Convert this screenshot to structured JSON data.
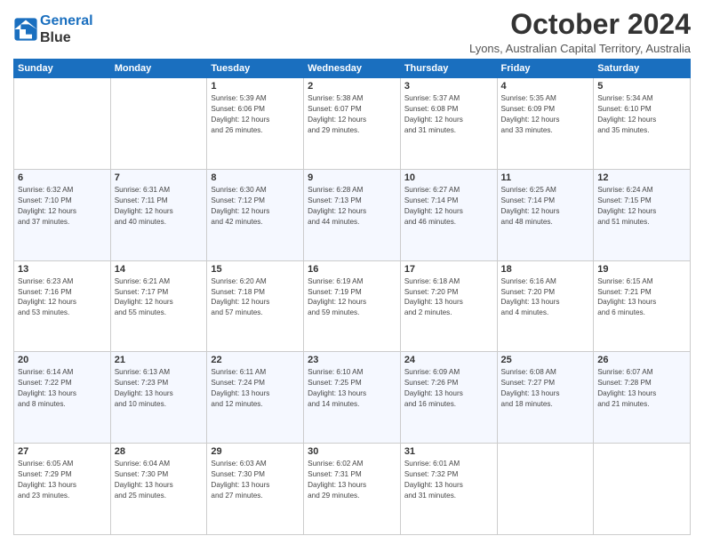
{
  "header": {
    "logo_line1": "General",
    "logo_line2": "Blue",
    "month": "October 2024",
    "location": "Lyons, Australian Capital Territory, Australia"
  },
  "days_of_week": [
    "Sunday",
    "Monday",
    "Tuesday",
    "Wednesday",
    "Thursday",
    "Friday",
    "Saturday"
  ],
  "weeks": [
    [
      {
        "day": "",
        "info": ""
      },
      {
        "day": "",
        "info": ""
      },
      {
        "day": "1",
        "info": "Sunrise: 5:39 AM\nSunset: 6:06 PM\nDaylight: 12 hours\nand 26 minutes."
      },
      {
        "day": "2",
        "info": "Sunrise: 5:38 AM\nSunset: 6:07 PM\nDaylight: 12 hours\nand 29 minutes."
      },
      {
        "day": "3",
        "info": "Sunrise: 5:37 AM\nSunset: 6:08 PM\nDaylight: 12 hours\nand 31 minutes."
      },
      {
        "day": "4",
        "info": "Sunrise: 5:35 AM\nSunset: 6:09 PM\nDaylight: 12 hours\nand 33 minutes."
      },
      {
        "day": "5",
        "info": "Sunrise: 5:34 AM\nSunset: 6:10 PM\nDaylight: 12 hours\nand 35 minutes."
      }
    ],
    [
      {
        "day": "6",
        "info": "Sunrise: 6:32 AM\nSunset: 7:10 PM\nDaylight: 12 hours\nand 37 minutes."
      },
      {
        "day": "7",
        "info": "Sunrise: 6:31 AM\nSunset: 7:11 PM\nDaylight: 12 hours\nand 40 minutes."
      },
      {
        "day": "8",
        "info": "Sunrise: 6:30 AM\nSunset: 7:12 PM\nDaylight: 12 hours\nand 42 minutes."
      },
      {
        "day": "9",
        "info": "Sunrise: 6:28 AM\nSunset: 7:13 PM\nDaylight: 12 hours\nand 44 minutes."
      },
      {
        "day": "10",
        "info": "Sunrise: 6:27 AM\nSunset: 7:14 PM\nDaylight: 12 hours\nand 46 minutes."
      },
      {
        "day": "11",
        "info": "Sunrise: 6:25 AM\nSunset: 7:14 PM\nDaylight: 12 hours\nand 48 minutes."
      },
      {
        "day": "12",
        "info": "Sunrise: 6:24 AM\nSunset: 7:15 PM\nDaylight: 12 hours\nand 51 minutes."
      }
    ],
    [
      {
        "day": "13",
        "info": "Sunrise: 6:23 AM\nSunset: 7:16 PM\nDaylight: 12 hours\nand 53 minutes."
      },
      {
        "day": "14",
        "info": "Sunrise: 6:21 AM\nSunset: 7:17 PM\nDaylight: 12 hours\nand 55 minutes."
      },
      {
        "day": "15",
        "info": "Sunrise: 6:20 AM\nSunset: 7:18 PM\nDaylight: 12 hours\nand 57 minutes."
      },
      {
        "day": "16",
        "info": "Sunrise: 6:19 AM\nSunset: 7:19 PM\nDaylight: 12 hours\nand 59 minutes."
      },
      {
        "day": "17",
        "info": "Sunrise: 6:18 AM\nSunset: 7:20 PM\nDaylight: 13 hours\nand 2 minutes."
      },
      {
        "day": "18",
        "info": "Sunrise: 6:16 AM\nSunset: 7:20 PM\nDaylight: 13 hours\nand 4 minutes."
      },
      {
        "day": "19",
        "info": "Sunrise: 6:15 AM\nSunset: 7:21 PM\nDaylight: 13 hours\nand 6 minutes."
      }
    ],
    [
      {
        "day": "20",
        "info": "Sunrise: 6:14 AM\nSunset: 7:22 PM\nDaylight: 13 hours\nand 8 minutes."
      },
      {
        "day": "21",
        "info": "Sunrise: 6:13 AM\nSunset: 7:23 PM\nDaylight: 13 hours\nand 10 minutes."
      },
      {
        "day": "22",
        "info": "Sunrise: 6:11 AM\nSunset: 7:24 PM\nDaylight: 13 hours\nand 12 minutes."
      },
      {
        "day": "23",
        "info": "Sunrise: 6:10 AM\nSunset: 7:25 PM\nDaylight: 13 hours\nand 14 minutes."
      },
      {
        "day": "24",
        "info": "Sunrise: 6:09 AM\nSunset: 7:26 PM\nDaylight: 13 hours\nand 16 minutes."
      },
      {
        "day": "25",
        "info": "Sunrise: 6:08 AM\nSunset: 7:27 PM\nDaylight: 13 hours\nand 18 minutes."
      },
      {
        "day": "26",
        "info": "Sunrise: 6:07 AM\nSunset: 7:28 PM\nDaylight: 13 hours\nand 21 minutes."
      }
    ],
    [
      {
        "day": "27",
        "info": "Sunrise: 6:05 AM\nSunset: 7:29 PM\nDaylight: 13 hours\nand 23 minutes."
      },
      {
        "day": "28",
        "info": "Sunrise: 6:04 AM\nSunset: 7:30 PM\nDaylight: 13 hours\nand 25 minutes."
      },
      {
        "day": "29",
        "info": "Sunrise: 6:03 AM\nSunset: 7:30 PM\nDaylight: 13 hours\nand 27 minutes."
      },
      {
        "day": "30",
        "info": "Sunrise: 6:02 AM\nSunset: 7:31 PM\nDaylight: 13 hours\nand 29 minutes."
      },
      {
        "day": "31",
        "info": "Sunrise: 6:01 AM\nSunset: 7:32 PM\nDaylight: 13 hours\nand 31 minutes."
      },
      {
        "day": "",
        "info": ""
      },
      {
        "day": "",
        "info": ""
      }
    ]
  ]
}
